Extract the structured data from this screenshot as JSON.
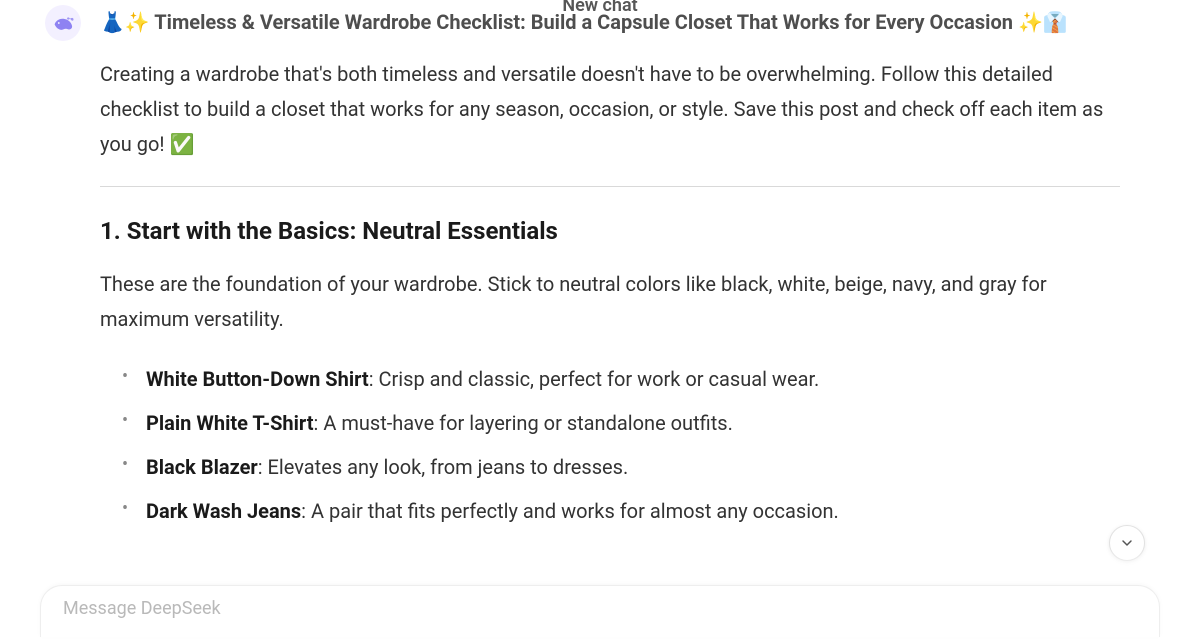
{
  "header": {
    "title": "New chat"
  },
  "message": {
    "title_prefix": "👗✨ ",
    "title_text": "Timeless & Versatile Wardrobe Checklist: Build a Capsule Closet That Works for Every Occasion",
    "title_suffix": " ✨👔",
    "intro": "Creating a wardrobe that's both timeless and versatile doesn't have to be overwhelming. Follow this detailed checklist to build a closet that works for any season, occasion, or style. Save this post and check off each item as you go! ✅",
    "section1": {
      "heading": "1. Start with the Basics: Neutral Essentials",
      "intro": "These are the foundation of your wardrobe. Stick to neutral colors like black, white, beige, navy, and gray for maximum versatility.",
      "items": [
        {
          "name": "White Button-Down Shirt",
          "desc": ": Crisp and classic, perfect for work or casual wear."
        },
        {
          "name": "Plain White T-Shirt",
          "desc": ": A must-have for layering or standalone outfits."
        },
        {
          "name": "Black Blazer",
          "desc": ": Elevates any look, from jeans to dresses."
        },
        {
          "name": "Dark Wash Jeans",
          "desc": ": A pair that fits perfectly and works for almost any occasion."
        }
      ]
    }
  },
  "composer": {
    "placeholder": "Message DeepSeek"
  }
}
